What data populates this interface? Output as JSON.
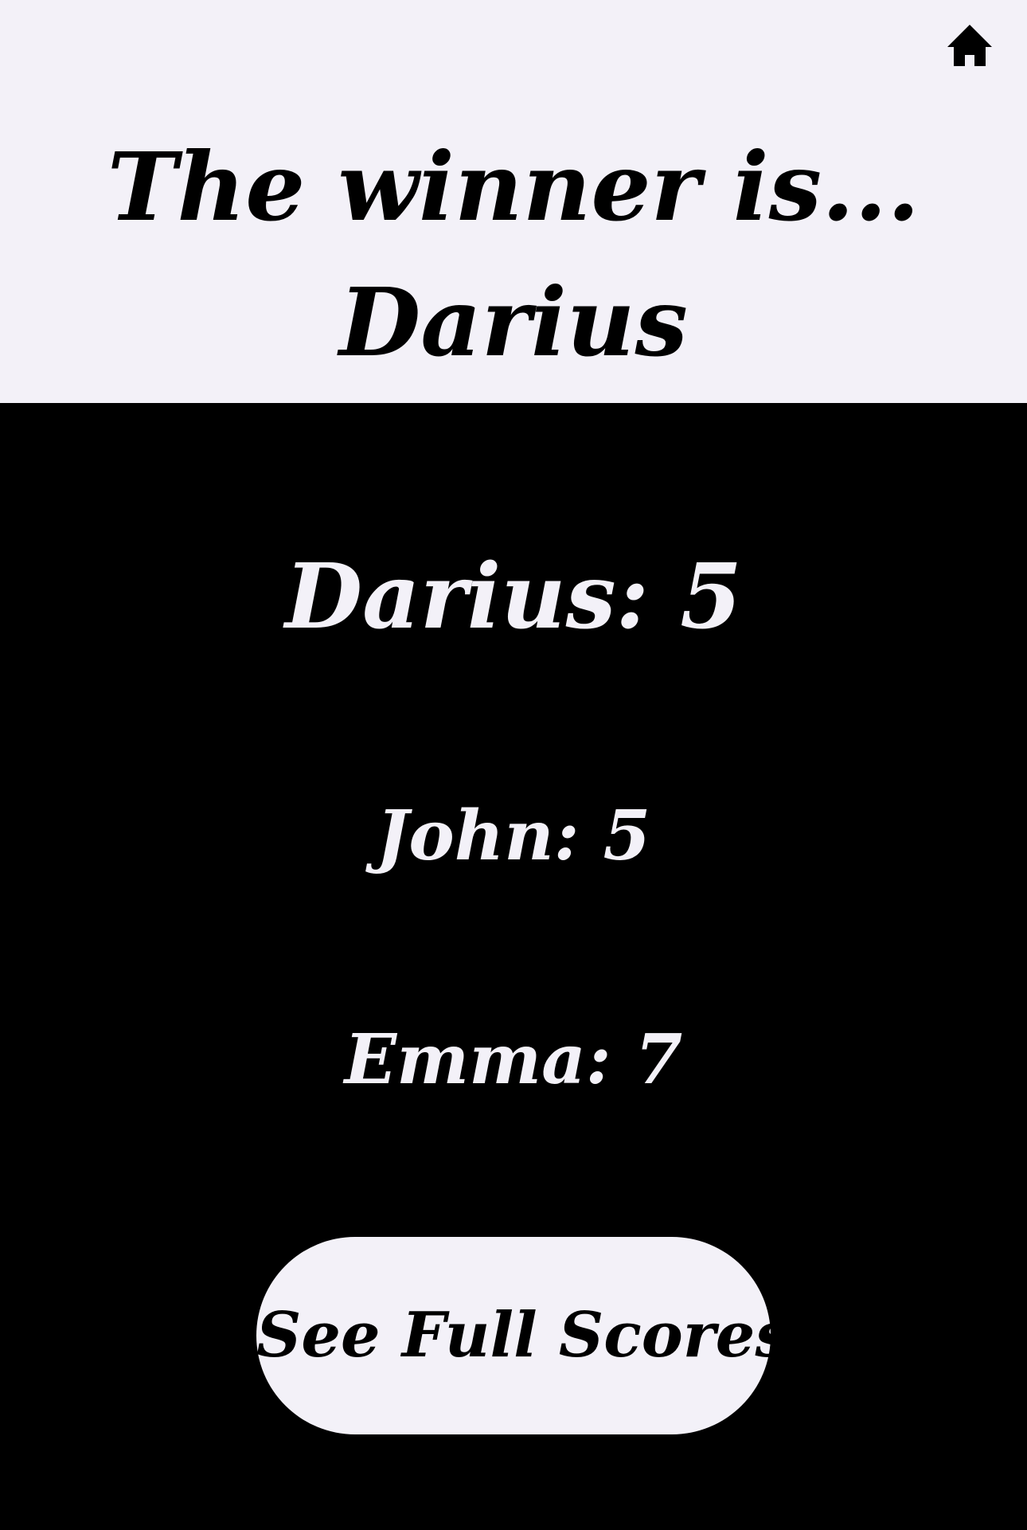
{
  "header": {
    "home_icon": "home-icon",
    "title": "The winner is...",
    "winner_name": "Darius"
  },
  "scores": {
    "winner_line": "Darius: 5",
    "others": [
      "John: 5",
      "Emma: 7"
    ]
  },
  "actions": {
    "full_scores_label": "See Full Scores"
  },
  "colors": {
    "light_background": "#f3f1f8",
    "dark_background": "#000000",
    "light_text": "#f3f1f8",
    "dark_text": "#000000"
  }
}
